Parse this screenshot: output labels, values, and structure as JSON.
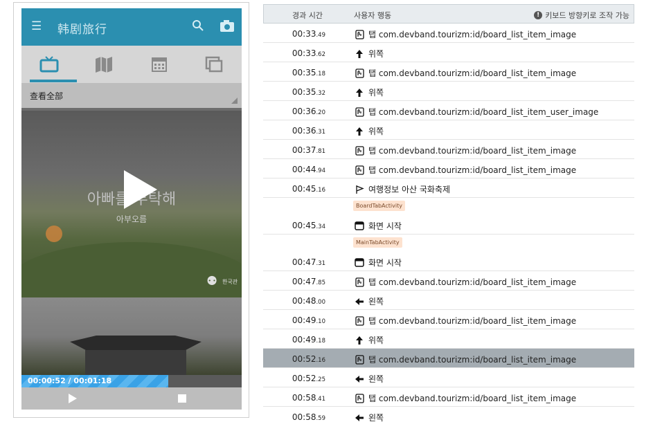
{
  "player": {
    "app_title": "韩剧旅行",
    "filter_label": "查看全部",
    "card1_title": "아빠를 부탁해",
    "card1_subtitle": "아부오름",
    "logo_text": "한국관",
    "time_display": "00:00:52 / 00:01:18",
    "progress": 0.667,
    "tabs": [
      "tv-icon",
      "map-icon",
      "calendar-icon",
      "gallery-icon"
    ]
  },
  "log": {
    "header": {
      "time_label": "경과 시간",
      "action_label": "사용자 행동",
      "hint_label": "키보드 방향키로 조작 가능"
    },
    "rows": [
      {
        "time_main": "00:33",
        "time_frac": ".49",
        "icon": "tap-icon",
        "text": "탭 com.devband.tourizm:id/board_list_item_image"
      },
      {
        "time_main": "00:33",
        "time_frac": ".62",
        "icon": "arrow-up-icon",
        "text": "위쪽"
      },
      {
        "time_main": "00:35",
        "time_frac": ".18",
        "icon": "tap-icon",
        "text": "탭 com.devband.tourizm:id/board_list_item_image"
      },
      {
        "time_main": "00:35",
        "time_frac": ".32",
        "icon": "arrow-up-icon",
        "text": "위쪽"
      },
      {
        "time_main": "00:36",
        "time_frac": ".20",
        "icon": "tap-icon",
        "text": "탭 com.devband.tourizm:id/board_list_item_user_image"
      },
      {
        "time_main": "00:36",
        "time_frac": ".31",
        "icon": "arrow-up-icon",
        "text": "위쪽"
      },
      {
        "time_main": "00:37",
        "time_frac": ".81",
        "icon": "tap-icon",
        "text": "탭 com.devband.tourizm:id/board_list_item_image"
      },
      {
        "time_main": "00:44",
        "time_frac": ".94",
        "icon": "tap-icon",
        "text": "탭 com.devband.tourizm:id/board_list_item_image"
      },
      {
        "time_main": "00:45",
        "time_frac": ".16",
        "icon": "flag-icon",
        "text": "여행정보 아산 국화축제"
      },
      {
        "tag": "BoardTabActivity"
      },
      {
        "time_main": "00:45",
        "time_frac": ".34",
        "icon": "screen-icon",
        "text": "화면 시작"
      },
      {
        "tag": "MainTabActivity"
      },
      {
        "time_main": "00:47",
        "time_frac": ".31",
        "icon": "screen-icon",
        "text": "화면 시작"
      },
      {
        "time_main": "00:47",
        "time_frac": ".85",
        "icon": "tap-icon",
        "text": "탭 com.devband.tourizm:id/board_list_item_image"
      },
      {
        "time_main": "00:48",
        "time_frac": ".00",
        "icon": "arrow-left-icon",
        "text": "왼쪽"
      },
      {
        "time_main": "00:49",
        "time_frac": ".10",
        "icon": "tap-icon",
        "text": "탭 com.devband.tourizm:id/board_list_item_image"
      },
      {
        "time_main": "00:49",
        "time_frac": ".18",
        "icon": "arrow-up-icon",
        "text": "위쪽"
      },
      {
        "time_main": "00:52",
        "time_frac": ".16",
        "icon": "tap-icon",
        "text": "탭 com.devband.tourizm:id/board_list_item_image",
        "selected": true
      },
      {
        "time_main": "00:52",
        "time_frac": ".25",
        "icon": "arrow-left-icon",
        "text": "왼쪽"
      },
      {
        "time_main": "00:58",
        "time_frac": ".41",
        "icon": "tap-icon",
        "text": "탭 com.devband.tourizm:id/board_list_item_image"
      },
      {
        "time_main": "00:58",
        "time_frac": ".59",
        "icon": "arrow-left-icon",
        "text": "왼쪽"
      }
    ]
  },
  "colors": {
    "header_blue": "#2b8fb0",
    "progress_blue": "#3aa2e6",
    "selected_row": "#a4acb2",
    "tag_bg": "#fde2cf"
  }
}
